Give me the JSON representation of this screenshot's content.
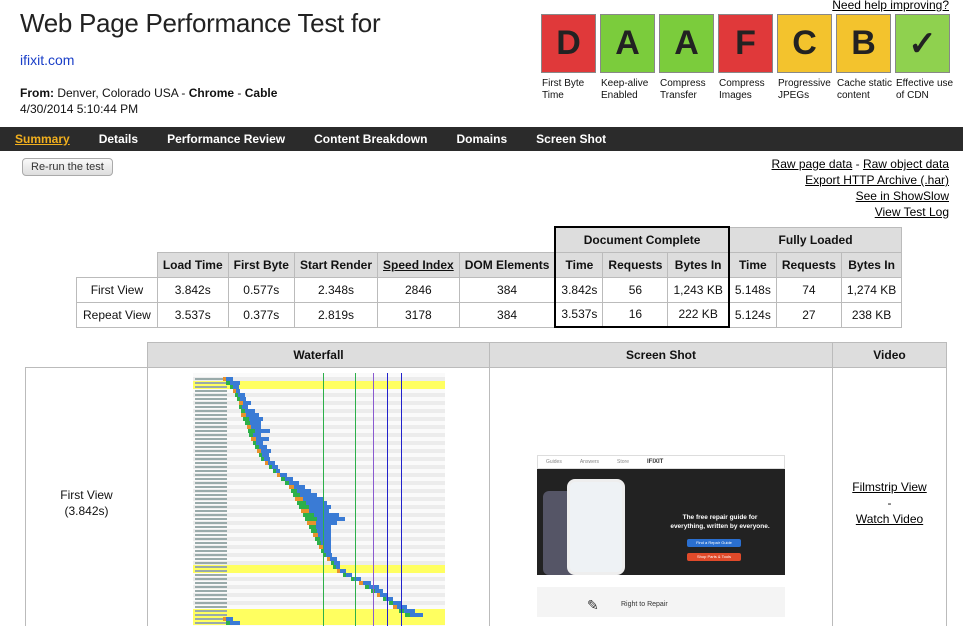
{
  "header": {
    "title": "Web Page Performance Test for",
    "site": "ifixit.com",
    "from_prefix": "From:",
    "location": "Denver, Colorado USA",
    "sep1": " - ",
    "browser": "Chrome",
    "sep2": " - ",
    "connection": "Cable",
    "date": "4/30/2014 5:10:44 PM",
    "help_link": "Need help improving?"
  },
  "grades": [
    {
      "letter": "D",
      "label": "First Byte Time",
      "color": "#e0393a"
    },
    {
      "letter": "A",
      "label": "Keep-alive Enabled",
      "color": "#7bcc3c"
    },
    {
      "letter": "A",
      "label": "Compress Transfer",
      "color": "#7bcc3c"
    },
    {
      "letter": "F",
      "label": "Compress Images",
      "color": "#e0393a"
    },
    {
      "letter": "C",
      "label": "Progressive JPEGs",
      "color": "#f3c32d"
    },
    {
      "letter": "B",
      "label": "Cache static content",
      "color": "#f3c32d"
    },
    {
      "letter": "✓",
      "label": "Effective use of CDN",
      "color": "#8fd14f"
    }
  ],
  "nav": [
    "Summary",
    "Details",
    "Performance Review",
    "Content Breakdown",
    "Domains",
    "Screen Shot"
  ],
  "rerun_label": "Re-run the test",
  "right_links": {
    "raw_page": "Raw page data",
    "dash": " - ",
    "raw_object": "Raw object data",
    "export": "Export HTTP Archive (.har)",
    "showslow": "See in ShowSlow",
    "view_log": "View Test Log"
  },
  "results": {
    "group_headers": [
      "Document Complete",
      "Fully Loaded"
    ],
    "columns": [
      "Load Time",
      "First Byte",
      "Start Render",
      "Speed Index",
      "DOM Elements",
      "Time",
      "Requests",
      "Bytes In",
      "Time",
      "Requests",
      "Bytes In"
    ],
    "rows": [
      {
        "label": "First View",
        "cells": [
          "3.842s",
          "0.577s",
          "2.348s",
          "2846",
          "384",
          "3.842s",
          "56",
          "1,243 KB",
          "5.148s",
          "74",
          "1,274 KB"
        ]
      },
      {
        "label": "Repeat View",
        "cells": [
          "3.537s",
          "0.377s",
          "2.819s",
          "3178",
          "384",
          "3.537s",
          "16",
          "222 KB",
          "5.124s",
          "27",
          "238 KB"
        ]
      }
    ]
  },
  "media": {
    "headers": [
      "Waterfall",
      "Screen Shot",
      "Video"
    ],
    "row_label": "First View",
    "row_time": "(3.842s)",
    "filmstrip": "Filmstrip View",
    "dash": "-",
    "watch_video": "Watch Video",
    "screenshot": {
      "nav": [
        "Guides",
        "Answers",
        "Store"
      ],
      "brand": "IFIXIT",
      "tagline": "The free repair guide for everything, written by everyone.",
      "button1": "Find a Repair Guide",
      "button2": "Shop Parts & Tools",
      "bottom": "Right to Repair"
    }
  },
  "colors": {
    "nav_bg": "#2b2b2b",
    "nav_active": "#f2b01e",
    "link_blue": "#1a3fc8",
    "header_grey": "#dddddd"
  }
}
